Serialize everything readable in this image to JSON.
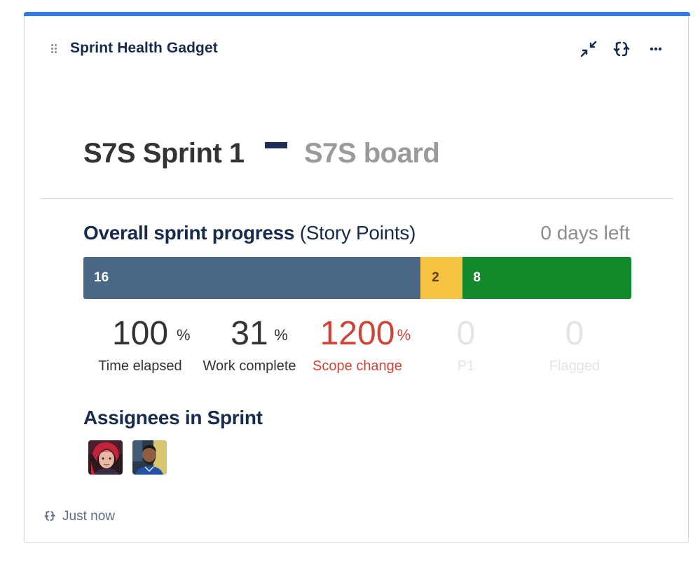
{
  "gadget": {
    "title": "Sprint Health Gadget",
    "icons": [
      "drag-handle-icon",
      "minimize-icon",
      "refresh-icon",
      "more-icon"
    ]
  },
  "sprint": {
    "name": "S7S Sprint 1",
    "board": "S7S board"
  },
  "progress": {
    "title": "Overall sprint progress",
    "unit": "(Story Points)",
    "days_left": "0 days left",
    "segments": [
      {
        "status": "to-do",
        "value": 16,
        "label": "16",
        "color": "#4a6785"
      },
      {
        "status": "in-progress",
        "value": 2,
        "label": "2",
        "color": "#f6c342"
      },
      {
        "status": "done",
        "value": 8,
        "label": "8",
        "color": "#14892c"
      }
    ]
  },
  "stats": {
    "time_elapsed": {
      "value": "100",
      "unit": "%",
      "label": "Time elapsed"
    },
    "work_complete": {
      "value": "31",
      "unit": "%",
      "label": "Work complete"
    },
    "scope_change": {
      "value": "1200",
      "unit": "%",
      "label": "Scope change",
      "color": "#d04437"
    },
    "p1": {
      "value": "0",
      "label": "P1"
    },
    "flagged": {
      "value": "0",
      "label": "Flagged"
    }
  },
  "assignees": {
    "title": "Assignees in Sprint",
    "avatars": [
      "avatar-red-hair",
      "avatar-blue-shirt"
    ]
  },
  "footer": {
    "updated": "Just now"
  },
  "colors": {
    "accent": "#2f7be5",
    "heading": "#172b4d",
    "scope_change": "#d04437"
  }
}
